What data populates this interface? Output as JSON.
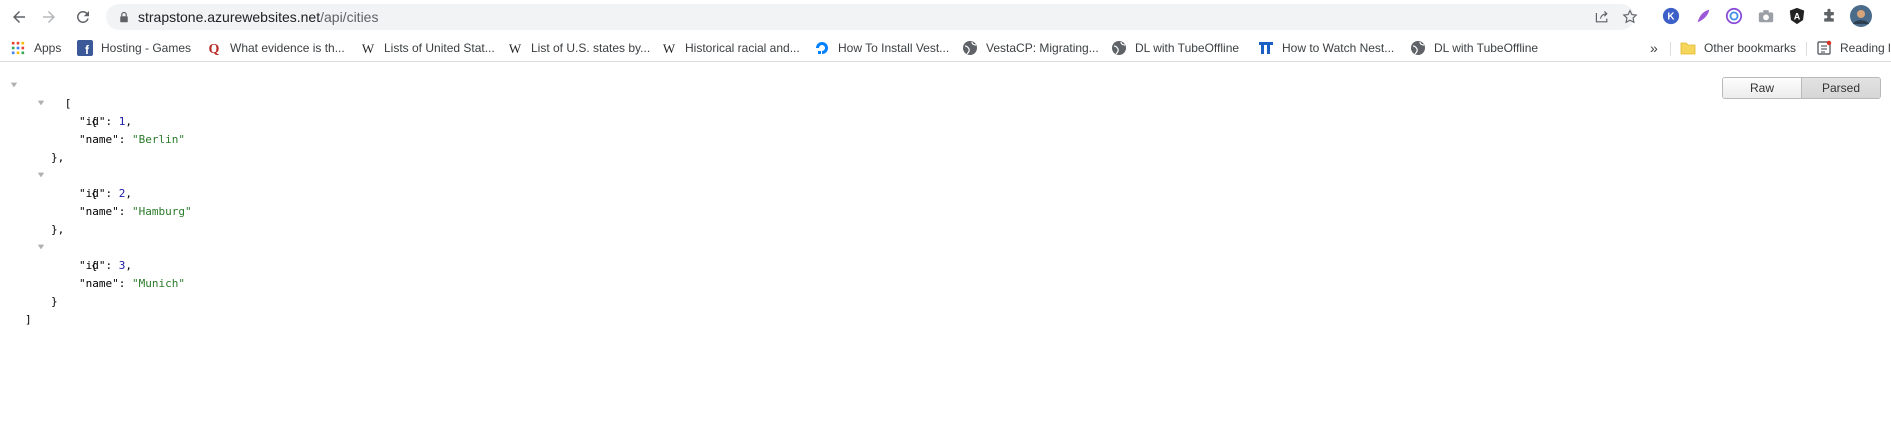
{
  "omnibox": {
    "host": "strapstone.azurewebsites.net",
    "path": "/api/cities"
  },
  "bookmarks": {
    "apps": "Apps",
    "items": [
      {
        "label": "Hosting - Games",
        "icon": "facebook-icon"
      },
      {
        "label": "What evidence is th...",
        "icon": "quora-icon"
      },
      {
        "label": "Lists of United Stat...",
        "icon": "wikipedia-icon"
      },
      {
        "label": "List of U.S. states by...",
        "icon": "wikipedia-icon"
      },
      {
        "label": "Historical racial and...",
        "icon": "wikipedia-icon"
      },
      {
        "label": "How To Install Vest...",
        "icon": "digitalocean-icon"
      },
      {
        "label": "VestaCP: Migrating...",
        "icon": "globe-icon"
      },
      {
        "label": "DL with TubeOffline",
        "icon": "globe-icon"
      },
      {
        "label": "How to Watch Nest...",
        "icon": "tech-site-icon"
      },
      {
        "label": "DL with TubeOffline",
        "icon": "globe-icon"
      }
    ],
    "more": "»",
    "other": "Other bookmarks",
    "reading": "Reading list"
  },
  "json_view": {
    "open_bracket": "[",
    "close_bracket": "]",
    "open_brace": "{",
    "close_brace": "},",
    "last_close_brace": "}",
    "records": [
      {
        "id_key": "\"id\"",
        "id_value": "1",
        "name_key": "\"name\"",
        "name_value": "\"Berlin\""
      },
      {
        "id_key": "\"id\"",
        "id_value": "2",
        "name_key": "\"name\"",
        "name_value": "\"Hamburg\""
      },
      {
        "id_key": "\"id\"",
        "id_value": "3",
        "name_key": "\"name\"",
        "name_value": "\"Munich\""
      }
    ]
  },
  "view_toggle": {
    "raw": "Raw",
    "parsed": "Parsed",
    "active": "parsed"
  }
}
